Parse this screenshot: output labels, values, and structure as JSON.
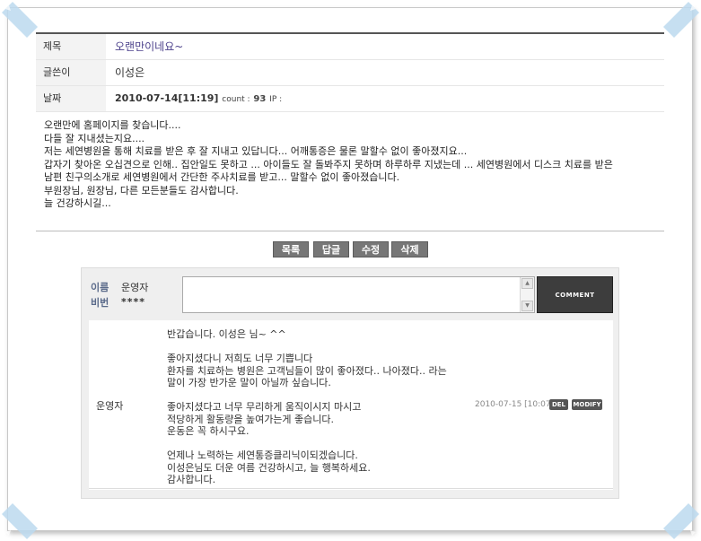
{
  "post": {
    "title_label": "제목",
    "title": "오랜만이네요~",
    "author_label": "글쓴이",
    "author": "이성은",
    "date_label": "날짜",
    "date": "2010-07-14[11:19]",
    "count_label": "count :",
    "count": "93",
    "ip_label": "IP :",
    "ip": "",
    "body": [
      "오랜만에 홈페이지를 찾습니다....",
      "다들 잘 지내셨는지요....",
      "저는 세연병원을 통해 치료를 받은 후 잘 지내고 있답니다... 어깨통증은 물론 말할수 없이 좋아졌지요...",
      "갑자기 찾아온 오십견으로 인해.. 집안일도 못하고 ... 아이들도 잘 돌봐주지 못하며 하루하루 지냈는데 ... 세연병원에서 디스크 치료를 받은",
      "남편 친구의소개로 세연병원에서 간단한 주사치료를 받고... 말할수 없이 좋아졌습니다.",
      "부원장님, 원장님, 다른 모든분들도 감사합니다.",
      "늘 건강하시길..."
    ]
  },
  "buttons": {
    "list": "목록",
    "reply": "답글",
    "edit": "수정",
    "delete": "삭제"
  },
  "comment_form": {
    "name_label": "이름",
    "name_value": "운영자",
    "pw_label": "비번",
    "pw_value": "****",
    "submit": "COMMENT"
  },
  "comments": [
    {
      "author": "운영자",
      "date": "2010-07-15 [10:07]",
      "del_label": "DEL",
      "modify_label": "MODIFY",
      "lines": [
        "반갑습니다. 이성은 님~ ^^",
        "",
        "좋아지셨다니 저희도 너무 기쁩니다",
        "환자를 치료하는 병원은 고객님들이 많이 좋아졌다.. 나아졌다.. 라는",
        "말이 가장 반가운 말이 아닐까 싶습니다.",
        "",
        "좋아지셨다고 너무 무리하게 움직이시지 마시고",
        "적당하게 활동량을 높여가는게 좋습니다.",
        "운동은 꼭 하시구요.",
        "",
        "언제나 노력하는 세연통증클리닉이되겠습니다.",
        "이성은님도 더운 여름 건강하시고, 늘 행복하세요.",
        "감사합니다."
      ]
    }
  ],
  "colors": {
    "title": "#4a3f8a",
    "button": "#777777",
    "comment_button": "#3d3d3d",
    "label_bg": "#f3f3f3",
    "corner_tape": "#bcd9ef"
  }
}
